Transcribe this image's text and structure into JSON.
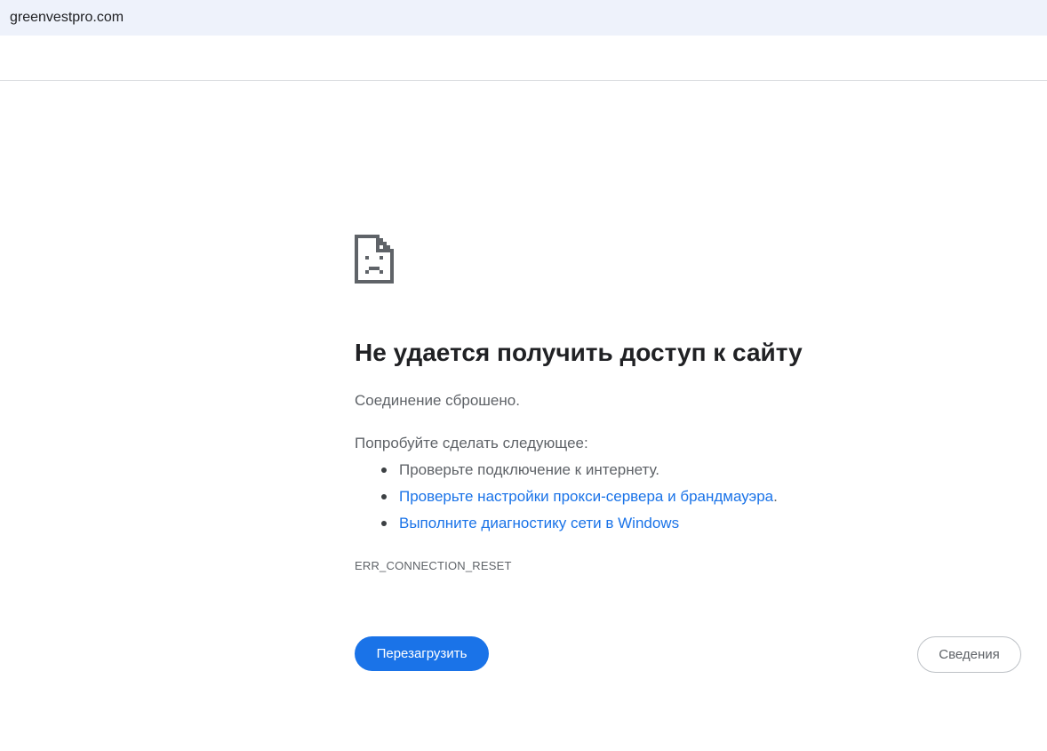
{
  "address_bar": {
    "url": "greenvestpro.com"
  },
  "error_page": {
    "icon": "sad-document-icon",
    "heading": "Не удается получить доступ к сайту",
    "message": "Соединение сброшено.",
    "try_label": "Попробуйте сделать следующее:",
    "suggestions": [
      {
        "text": "Проверьте подключение к интернету.",
        "suffix": "",
        "is_link": false
      },
      {
        "text": "Проверьте настройки прокси-сервера и брандмауэра",
        "suffix": ".",
        "is_link": true
      },
      {
        "text": "Выполните диагностику сети в Windows",
        "suffix": "",
        "is_link": true
      }
    ],
    "error_code": "ERR_CONNECTION_RESET",
    "reload_label": "Перезагрузить",
    "details_label": "Сведения"
  },
  "colors": {
    "accent": "#1a73e8",
    "address_bar_bg": "#eef2fb",
    "text_primary": "#202124",
    "text_secondary": "#5f6368"
  }
}
